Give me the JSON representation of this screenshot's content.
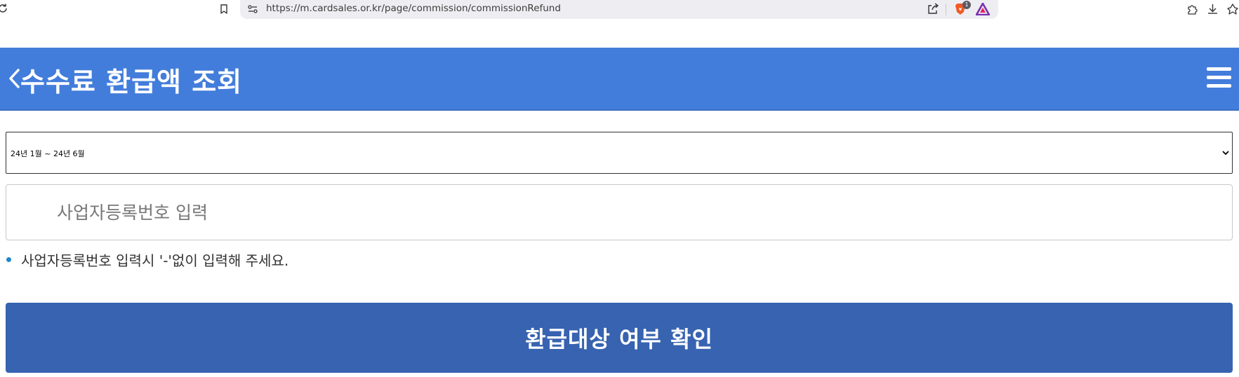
{
  "browser": {
    "url": "https://m.cardsales.or.kr/page/commission/commissionRefund",
    "brave_badge_count": "1"
  },
  "header": {
    "title": "수수료 환급액 조회"
  },
  "form": {
    "period_selected": "24년 1월 ~ 24년 6월",
    "bizno_placeholder": "사업자등록번호 입력",
    "bizno_value": "",
    "notice": "사업자등록번호 입력시 '-'없이 입력해 주세요.",
    "submit_label": "환급대상 여부 확인"
  },
  "colors": {
    "header_bg": "#437ddb",
    "button_bg": "#3763b0",
    "bullet": "#1e88c8"
  },
  "icons": [
    "reload-icon",
    "bookmark-icon",
    "site-info-icon",
    "share-icon",
    "brave-shield-icon",
    "brave-rewards-icon",
    "extensions-icon",
    "download-icon",
    "pin-icon",
    "back-arrow-icon",
    "hamburger-menu-icon",
    "chevron-down-icon"
  ]
}
